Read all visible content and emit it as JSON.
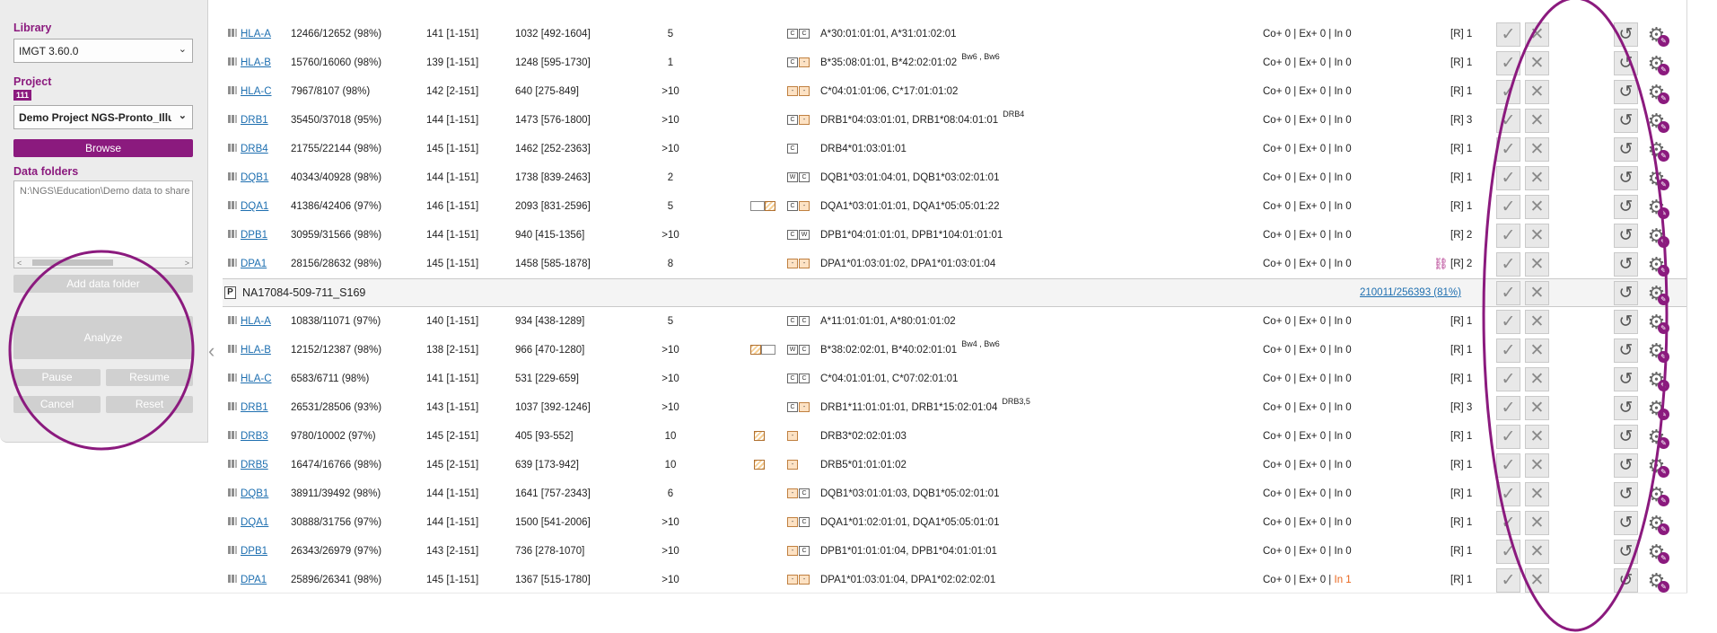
{
  "sidebar": {
    "library_label": "Library",
    "library_value": "IMGT 3.60.0",
    "project_label": "Project",
    "project_badge": "111",
    "project_value": "Demo Project NGS-Pronto_Illumina",
    "browse_label": "Browse",
    "data_folders_label": "Data folders",
    "data_folder_path": "N:\\NGS\\Education\\Demo data to share",
    "add_folder_label": "Add data folder",
    "analyze_label": "Analyze",
    "pause_label": "Pause",
    "resume_label": "Resume",
    "cancel_label": "Cancel",
    "reset_label": "Reset"
  },
  "sample": {
    "icon": "P",
    "name": "NA17084-509-711_S169",
    "reads": "210011/256393 (81%)"
  },
  "rows_top": [
    {
      "locus": "HLA-A",
      "reads": "12466/12652 (98%)",
      "pos": "141 [1-151]",
      "len": "1032 [492-1604]",
      "num": "5",
      "s1": "",
      "s2": "C C",
      "typing": "A*30:01:01:01, A*31:01:02:01",
      "sup": "",
      "stats": "Co+ 0 | Ex+ 0 | In 0",
      "stats_in": "",
      "r": "[R] 1"
    },
    {
      "locus": "HLA-B",
      "reads": "15760/16060 (98%)",
      "pos": "139 [1-151]",
      "len": "1248 [595-1730]",
      "num": "1",
      "s1": "",
      "s2": "C -",
      "typing": "B*35:08:01:01, B*42:02:01:02",
      "sup": "Bw6 , Bw6",
      "stats": "Co+ 0 | Ex+ 0 | In 0",
      "stats_in": "",
      "r": "[R] 1"
    },
    {
      "locus": "HLA-C",
      "reads": "7967/8107 (98%)",
      "pos": "142 [2-151]",
      "len": "640 [275-849]",
      "num": ">10",
      "s1": "",
      "s2": "- -",
      "typing": "C*04:01:01:06, C*17:01:01:02",
      "sup": "",
      "stats": "Co+ 0 | Ex+ 0 | In 0",
      "stats_in": "",
      "r": "[R] 1"
    },
    {
      "locus": "DRB1",
      "reads": "35450/37018 (95%)",
      "pos": "144 [1-151]",
      "len": "1473 [576-1800]",
      "num": ">10",
      "s1": "",
      "s2": "C -",
      "typing": "DRB1*04:03:01:01, DRB1*08:04:01:01",
      "sup": "DRB4",
      "stats": "Co+ 0 | Ex+ 0 | In 0",
      "stats_in": "",
      "r": "[R] 3"
    },
    {
      "locus": "DRB4",
      "reads": "21755/22144 (98%)",
      "pos": "145 [1-151]",
      "len": "1462 [252-2363]",
      "num": ">10",
      "s1": "",
      "s2": "C",
      "typing": "DRB4*01:03:01:01",
      "sup": "",
      "stats": "Co+ 0 | Ex+ 0 | In 0",
      "stats_in": "",
      "r": "[R] 1"
    },
    {
      "locus": "DQB1",
      "reads": "40343/40928 (98%)",
      "pos": "144 [1-151]",
      "len": "1738 [839-2463]",
      "num": "2",
      "s1": "",
      "s2": "W C",
      "typing": "DQB1*03:01:04:01, DQB1*03:02:01:01",
      "sup": "",
      "stats": "Co+ 0 | Ex+ 0 | In 0",
      "stats_in": "",
      "r": "[R] 1"
    },
    {
      "locus": "DQA1",
      "reads": "41386/42406 (97%)",
      "pos": "146 [1-151]",
      "len": "2093 [831-2596]",
      "num": "5",
      "s1": "box-hatch",
      "s2": "C -",
      "typing": "DQA1*03:01:01:01, DQA1*05:05:01:22",
      "sup": "",
      "stats": "Co+ 0 | Ex+ 0 | In 0",
      "stats_in": "",
      "r": "[R] 1"
    },
    {
      "locus": "DPB1",
      "reads": "30959/31566 (98%)",
      "pos": "144 [1-151]",
      "len": "940 [415-1356]",
      "num": ">10",
      "s1": "",
      "s2": "C W",
      "typing": "DPB1*04:01:01:01, DPB1*104:01:01:01",
      "sup": "",
      "stats": "Co+ 0 | Ex+ 0 | In 0",
      "stats_in": "",
      "r": "[R] 2"
    },
    {
      "locus": "DPA1",
      "reads": "28156/28632 (98%)",
      "pos": "145 [1-151]",
      "len": "1458 [585-1878]",
      "num": "8",
      "s1": "",
      "s2": "- -",
      "typing": "DPA1*01:03:01:02, DPA1*01:03:01:04",
      "sup": "",
      "stats": "Co+ 0 | Ex+ 0 | In 0",
      "stats_in": "",
      "r": "[R] 2"
    }
  ],
  "rows_bottom": [
    {
      "locus": "HLA-A",
      "reads": "10838/11071 (97%)",
      "pos": "140 [1-151]",
      "len": "934 [438-1289]",
      "num": "5",
      "s1": "",
      "s2": "C C",
      "typing": "A*11:01:01:01, A*80:01:01:02",
      "sup": "",
      "stats": "Co+ 0 | Ex+ 0 | In 0",
      "stats_in": "",
      "r": "[R] 1"
    },
    {
      "locus": "HLA-B",
      "reads": "12152/12387 (98%)",
      "pos": "138 [2-151]",
      "len": "966 [470-1280]",
      "num": ">10",
      "s1": "hatch-box",
      "s2": "W C",
      "typing": "B*38:02:02:01, B*40:02:01:01",
      "sup": "Bw4 , Bw6",
      "stats": "Co+ 0 | Ex+ 0 | In 0",
      "stats_in": "",
      "r": "[R] 1"
    },
    {
      "locus": "HLA-C",
      "reads": "6583/6711 (98%)",
      "pos": "141 [1-151]",
      "len": "531 [229-659]",
      "num": ">10",
      "s1": "",
      "s2": "C C",
      "typing": "C*04:01:01:01, C*07:02:01:01",
      "sup": "",
      "stats": "Co+ 0 | Ex+ 0 | In 0",
      "stats_in": "",
      "r": "[R] 1"
    },
    {
      "locus": "DRB1",
      "reads": "26531/28506 (93%)",
      "pos": "143 [1-151]",
      "len": "1037 [392-1246]",
      "num": ">10",
      "s1": "",
      "s2": "C -",
      "typing": "DRB1*11:01:01:01, DRB1*15:02:01:04",
      "sup": "DRB3,5",
      "stats": "Co+ 0 | Ex+ 0 | In 0",
      "stats_in": "",
      "r": "[R] 3"
    },
    {
      "locus": "DRB3",
      "reads": "9780/10002 (97%)",
      "pos": "145 [2-151]",
      "len": "405 [93-552]",
      "num": "10",
      "s1": "hatch",
      "s2": "-",
      "typing": "DRB3*02:02:01:03",
      "sup": "",
      "stats": "Co+ 0 | Ex+ 0 | In 0",
      "stats_in": "",
      "r": "[R] 1"
    },
    {
      "locus": "DRB5",
      "reads": "16474/16766 (98%)",
      "pos": "145 [2-151]",
      "len": "639 [173-942]",
      "num": "10",
      "s1": "hatch",
      "s2": "-",
      "typing": "DRB5*01:01:01:02",
      "sup": "",
      "stats": "Co+ 0 | Ex+ 0 | In 0",
      "stats_in": "",
      "r": "[R] 1"
    },
    {
      "locus": "DQB1",
      "reads": "38911/39492 (98%)",
      "pos": "144 [1-151]",
      "len": "1641 [757-2343]",
      "num": "6",
      "s1": "",
      "s2": "- C",
      "typing": "DQB1*03:01:01:03, DQB1*05:02:01:01",
      "sup": "",
      "stats": "Co+ 0 | Ex+ 0 | In 0",
      "stats_in": "",
      "r": "[R] 1"
    },
    {
      "locus": "DQA1",
      "reads": "30888/31756 (97%)",
      "pos": "144 [1-151]",
      "len": "1500 [541-2006]",
      "num": ">10",
      "s1": "",
      "s2": "- C",
      "typing": "DQA1*01:02:01:01, DQA1*05:05:01:01",
      "sup": "",
      "stats": "Co+ 0 | Ex+ 0 | In 0",
      "stats_in": "",
      "r": "[R] 1"
    },
    {
      "locus": "DPB1",
      "reads": "26343/26979 (97%)",
      "pos": "143 [2-151]",
      "len": "736 [278-1070]",
      "num": ">10",
      "s1": "",
      "s2": "- C",
      "typing": "DPB1*01:01:01:04, DPB1*04:01:01:01",
      "sup": "",
      "stats": "Co+ 0 | Ex+ 0 | ",
      "stats_in": "In 0",
      "r": "[R] 1"
    },
    {
      "locus": "DPA1",
      "reads": "25896/26341 (98%)",
      "pos": "145 [1-151]",
      "len": "1367 [515-1780]",
      "num": ">10",
      "s1": "",
      "s2": "- -",
      "typing": "DPA1*01:03:01:04, DPA1*02:02:02:01",
      "sup": "",
      "stats": "Co+ 0 | Ex+ 0 | ",
      "stats_in": "In 1",
      "r": "[R] 1"
    }
  ],
  "icons": {
    "approve": "check-icon",
    "reject": "close-icon",
    "reset": "refresh-icon",
    "settings": "gear-icon",
    "unlinked": "broken-link-icon",
    "collapse": "chevron-left-icon"
  },
  "colors": {
    "accent": "#8b1a7e",
    "link": "#1e6fb0",
    "warning": "#e8651c",
    "annotation": "#8b1a7e"
  }
}
